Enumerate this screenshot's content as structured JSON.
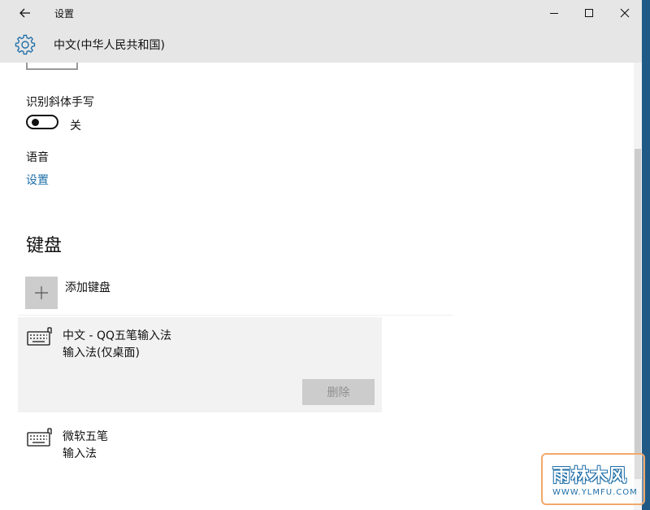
{
  "window": {
    "title": "设置",
    "header_title": "中文(中华人民共和国)"
  },
  "handwriting": {
    "label": "识别斜体手写",
    "toggle_state": "关",
    "toggle_on": false
  },
  "speech": {
    "label": "语音",
    "link": "设置"
  },
  "keyboards": {
    "section_title": "键盘",
    "add_label": "添加键盘",
    "items": [
      {
        "name": "中文 - QQ五笔输入法",
        "sub": "输入法(仅桌面)",
        "selected": true,
        "delete_label": "删除"
      },
      {
        "name": "微软五笔",
        "sub": "输入法",
        "selected": false
      }
    ]
  },
  "watermark": {
    "text": "雨林木风",
    "url": "WWW.YLMFU.COM"
  },
  "icons": [
    "back-arrow-icon",
    "minimize-icon",
    "maximize-icon",
    "close-icon",
    "gear-icon",
    "plus-icon",
    "keyboard-icon"
  ]
}
